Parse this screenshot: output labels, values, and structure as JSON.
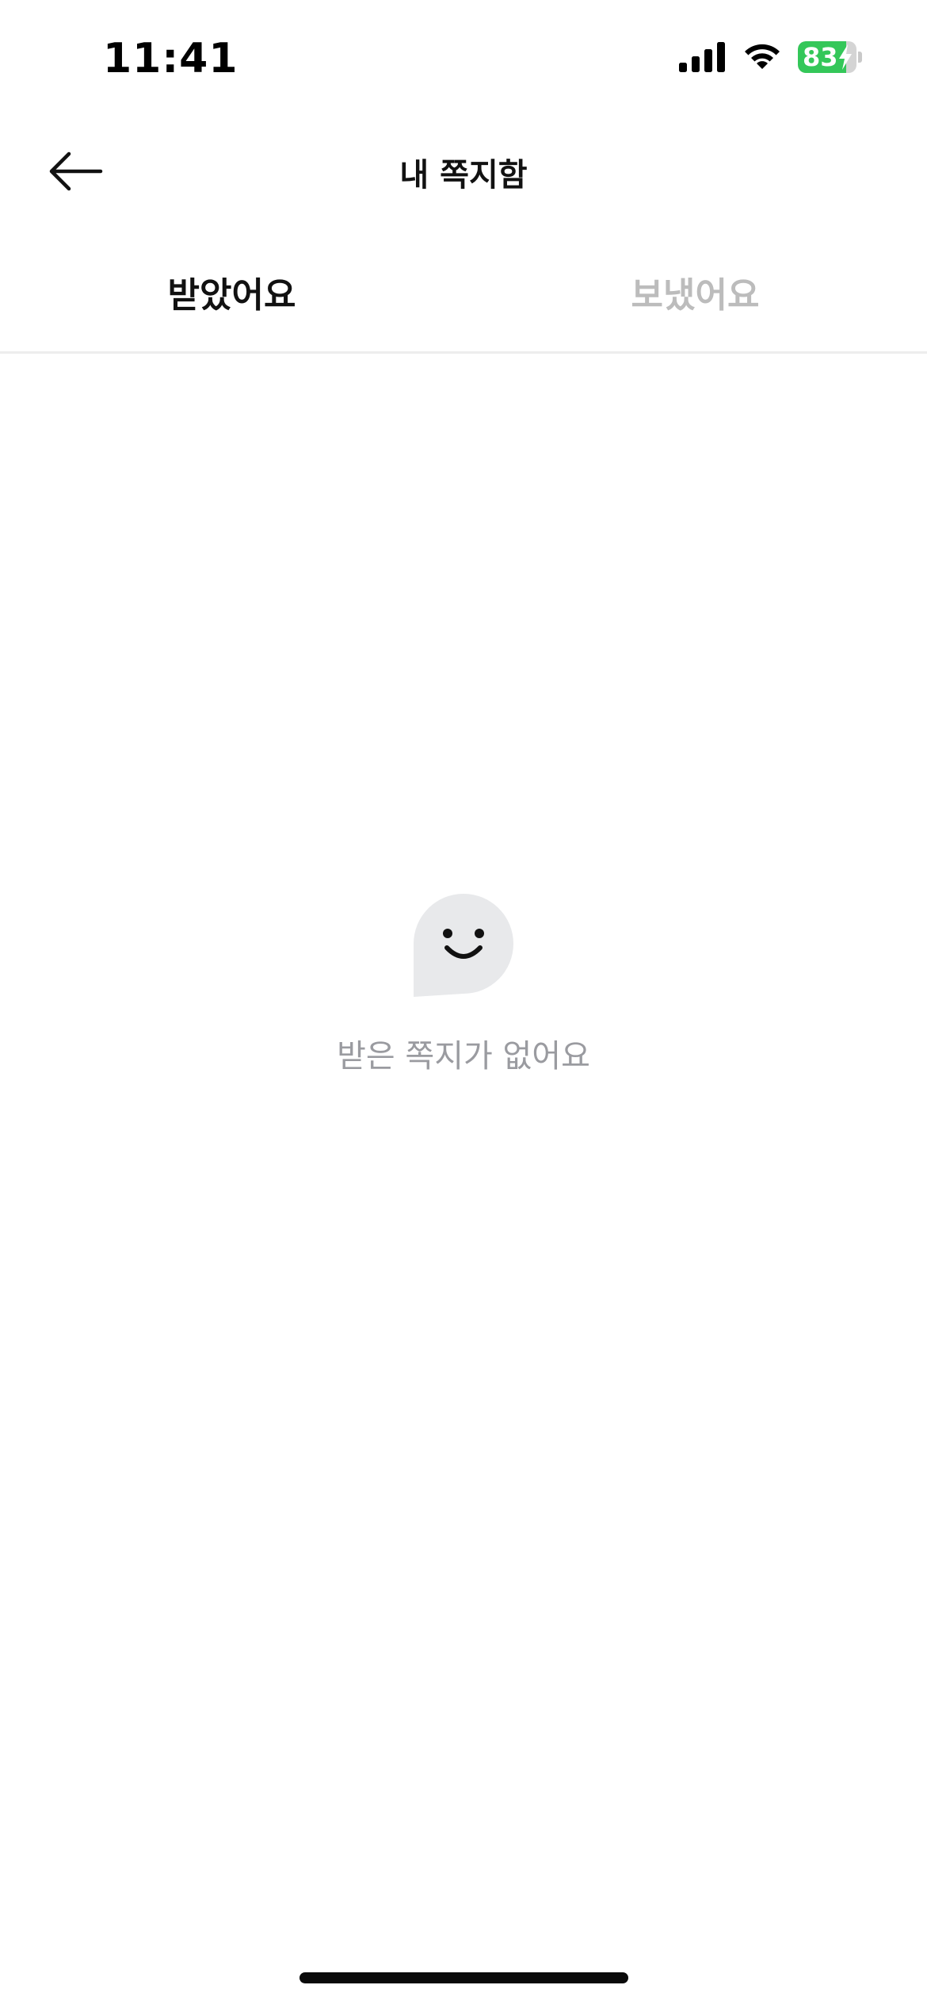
{
  "status_bar": {
    "time": "11:41",
    "battery_level": "83",
    "battery_fill_fraction": 0.83,
    "battery_color": "#34c759",
    "icons": [
      "cellular-signal-icon",
      "wifi-icon",
      "battery-icon"
    ]
  },
  "header": {
    "title": "내 쪽지함",
    "back_icon": "arrow-left-icon"
  },
  "tabs": [
    {
      "label": "받았어요",
      "active": true
    },
    {
      "label": "보냈어요",
      "active": false
    }
  ],
  "empty_state": {
    "icon": "smiling-speech-bubble-icon",
    "message": "받은 쪽지가 없어요"
  },
  "colors": {
    "text_primary": "#111111",
    "text_inactive_tab": "#bcbcbc",
    "text_empty": "#9a9ba0",
    "bubble_fill": "#e8e9eb",
    "divider": "#ededed"
  }
}
